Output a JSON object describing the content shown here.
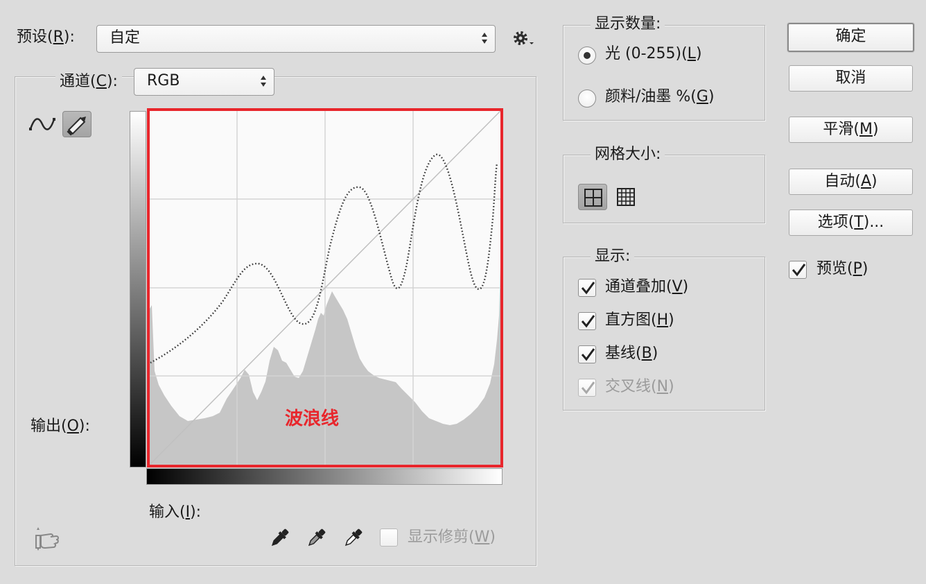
{
  "preset": {
    "label": "预设(",
    "key": "R",
    "suffix": "):",
    "value": "自定"
  },
  "channel": {
    "label": "通道(",
    "key": "C",
    "suffix": "):",
    "value": "RGB"
  },
  "output": {
    "label": "输出(",
    "key": "O",
    "suffix": "):"
  },
  "input": {
    "label": "输入(",
    "key": "I",
    "suffix": "):"
  },
  "annotation": {
    "text": "波浪线",
    "color": "#e8262c"
  },
  "show_clipping": {
    "label": "显示修剪(",
    "key": "W",
    "suffix": ")",
    "checked": false,
    "enabled": false
  },
  "show_amount": {
    "title": "显示数量:",
    "light": {
      "label": "光 (0-255)(",
      "key": "L",
      "suffix": ")",
      "selected": true
    },
    "pigment": {
      "label": "颜料/油墨 %(",
      "key": "G",
      "suffix": ")",
      "selected": false
    }
  },
  "grid_size": {
    "title": "网格大小:",
    "selected": "simple"
  },
  "display": {
    "title": "显示:",
    "channel_overlays": {
      "label": "通道叠加(",
      "key": "V",
      "suffix": ")",
      "checked": true
    },
    "histogram": {
      "label": "直方图(",
      "key": "H",
      "suffix": ")",
      "checked": true
    },
    "baseline": {
      "label": "基线(",
      "key": "B",
      "suffix": ")",
      "checked": true
    },
    "intersection": {
      "label": "交叉线(",
      "key": "N",
      "suffix": ")",
      "checked": true,
      "enabled": false
    }
  },
  "buttons": {
    "ok": "确定",
    "cancel": "取消",
    "smooth": {
      "label": "平滑(",
      "key": "M",
      "suffix": ")"
    },
    "auto": {
      "label": "自动(",
      "key": "A",
      "suffix": ")"
    },
    "options": {
      "label": "选项(",
      "key": "T",
      "suffix": ")..."
    }
  },
  "preview": {
    "label": "预览(",
    "key": "P",
    "suffix": ")",
    "checked": true
  },
  "icons": {
    "curve_tool": "curve-icon",
    "pencil_tool": "pencil-icon",
    "gear": "gear-icon",
    "hand": "hand-adjust-icon",
    "black_eyedropper": "eyedropper-black-icon",
    "gray_eyedropper": "eyedropper-gray-icon",
    "white_eyedropper": "eyedropper-white-icon"
  }
}
